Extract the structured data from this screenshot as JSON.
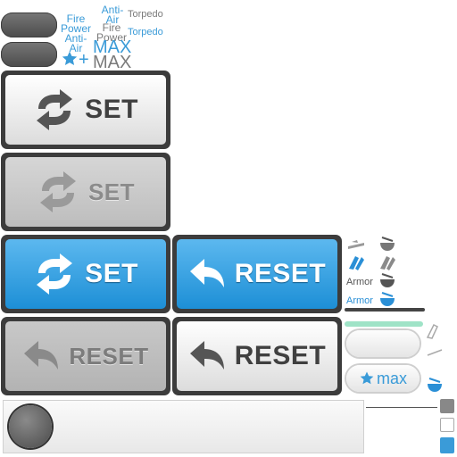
{
  "labels": {
    "fire_power_blue": "Fire Power",
    "anti_air_blue": "Anti-Air",
    "torpedo_grey": "Torpedo",
    "fire_power_grey": "Fire Power",
    "torpedo_blue": "Torpedo",
    "anti_air_grey": "Anti-Air",
    "plus": "+",
    "max_blue": "MAX",
    "max_grey": "MAX",
    "armor_grey": "Armor",
    "armor_blue": "Armor",
    "max_small": "max"
  },
  "buttons": {
    "set_normal": "SET",
    "set_disabled": "SET",
    "set_active": "SET",
    "reset_active": "RESET",
    "reset_disabled": "RESET",
    "reset_normal": "RESET"
  },
  "colors": {
    "accent_blue": "#3a9bd8",
    "dark_frame": "#3c3c3c",
    "label_grey": "#7a7a7a",
    "mint_bar": "#9fe3c7"
  },
  "icons": [
    "refresh-arrows-icon",
    "reset-arrow-icon",
    "star-icon",
    "aircraft-icon",
    "food-bowl-icon",
    "dice-icon",
    "gauge-knob-icon"
  ]
}
